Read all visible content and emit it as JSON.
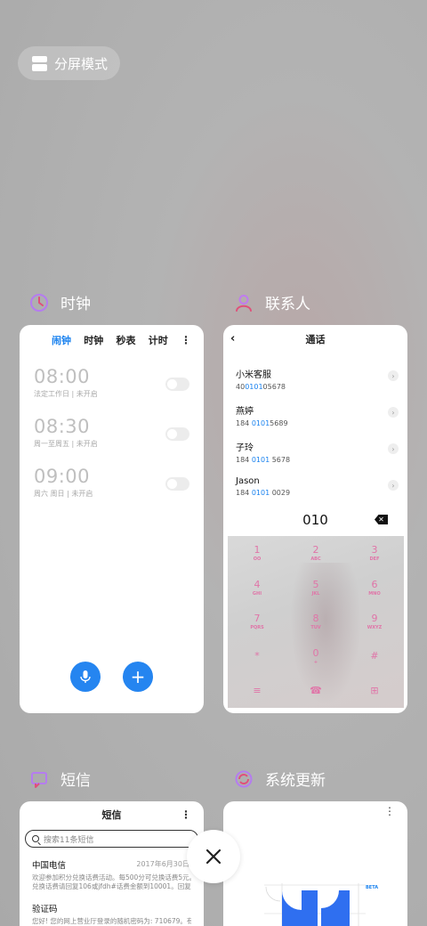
{
  "split_mode": {
    "label": "分屏模式"
  },
  "apps": {
    "clock": {
      "label": "时钟",
      "tabs": [
        "闹钟",
        "时钟",
        "秒表",
        "计时"
      ],
      "active_tab": 0,
      "more": "⋮",
      "alarms": [
        {
          "time": "08:00",
          "desc": "法定工作日 | 未开启",
          "enabled": false
        },
        {
          "time": "08:30",
          "desc": "周一至周五 | 未开启",
          "enabled": false
        },
        {
          "time": "09:00",
          "desc": "周六 周日 | 未开启",
          "enabled": false
        }
      ],
      "mic_icon": "microphone-icon",
      "add_label": "+"
    },
    "contacts": {
      "label": "联系人",
      "header_title": "通话",
      "back_glyph": "‹",
      "contacts": [
        {
          "name": "小米客服",
          "num_pre": "40",
          "num_hl": "0101",
          "num_post": "05678"
        },
        {
          "name": "燕婷",
          "num_pre": "184 ",
          "num_hl": "0101",
          "num_post": "5689"
        },
        {
          "name": "子玲",
          "num_pre": "184 ",
          "num_hl": "0101",
          "num_post": " 5678"
        },
        {
          "name": "Jason",
          "num_pre": "184 ",
          "num_hl": "0101",
          "num_post": " 0029"
        }
      ],
      "arrow_glyph": "›",
      "dialed": "010",
      "delete_glyph": "✕",
      "keys": [
        {
          "d": "1",
          "l": "OO"
        },
        {
          "d": "2",
          "l": "ABC"
        },
        {
          "d": "3",
          "l": "DEF"
        },
        {
          "d": "4",
          "l": "GHI"
        },
        {
          "d": "5",
          "l": "JKL"
        },
        {
          "d": "6",
          "l": "MNO"
        },
        {
          "d": "7",
          "l": "PQRS"
        },
        {
          "d": "8",
          "l": "TUV"
        },
        {
          "d": "9",
          "l": "WXYZ"
        },
        {
          "d": "*",
          "l": ""
        },
        {
          "d": "0",
          "l": "+"
        },
        {
          "d": "#",
          "l": ""
        },
        {
          "d": "≡",
          "l": ""
        },
        {
          "d": "☎",
          "l": ""
        },
        {
          "d": "⊞",
          "l": ""
        }
      ]
    },
    "sms": {
      "label": "短信",
      "header_title": "短信",
      "more": "⋮",
      "search_placeholder": "搜索11条短信",
      "messages": [
        {
          "from": "中国电信",
          "date": "2017年6月30日",
          "line1": "欢迎参加积分兑换话费活动。每500分可兑换话费5元。",
          "line2": "兑换话费请回复106或jfdh#话费金额到10001。回复..."
        },
        {
          "from": "验证码",
          "date": "",
          "line1": "您好! 您的网上营业厅登录的随机密码为: 710679。有",
          "line2": ""
        }
      ]
    },
    "update": {
      "label": "系统更新",
      "more": "⋮",
      "badge": "BETA"
    }
  },
  "close_button": {
    "icon": "close-icon",
    "glyph": "✕"
  },
  "colors": {
    "accent": "#1a82ef",
    "fab": "#2585f0",
    "keypad_digit": "#e075a8"
  }
}
